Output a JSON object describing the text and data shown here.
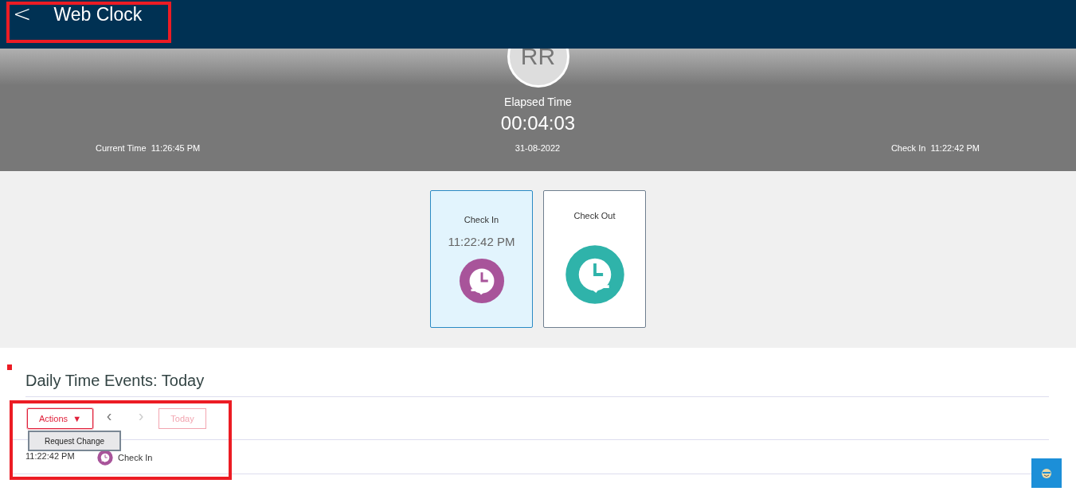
{
  "header": {
    "back": "<",
    "title": "Web Clock"
  },
  "summary": {
    "initials": "RR",
    "elapsed_label": "Elapsed Time",
    "elapsed": "00:04:03",
    "current_time_label": "Current Time",
    "current_time": "11:26:45 PM",
    "date": "31-08-2022",
    "check_in_label": "Check In",
    "check_in_time": "11:22:42 PM"
  },
  "cards": [
    {
      "kind": "check_in",
      "label": "Check In",
      "time": "11:22:42 PM",
      "selected": true
    },
    {
      "kind": "check_out",
      "label": "Check Out",
      "selected": false
    }
  ],
  "events": {
    "title": "Daily Time Events: Today",
    "actions": {
      "label": "Actions",
      "caret": "▼",
      "expanded": true,
      "menu": [
        "Request Change"
      ]
    },
    "prev": {
      "label": "‹",
      "disabled": false
    },
    "next": {
      "label": "›",
      "disabled": true
    },
    "today": {
      "label": "Today",
      "disabled": true
    },
    "rows": [
      {
        "time": "11:22:42 PM",
        "kind": "check_in",
        "label": "Check In"
      }
    ]
  }
}
